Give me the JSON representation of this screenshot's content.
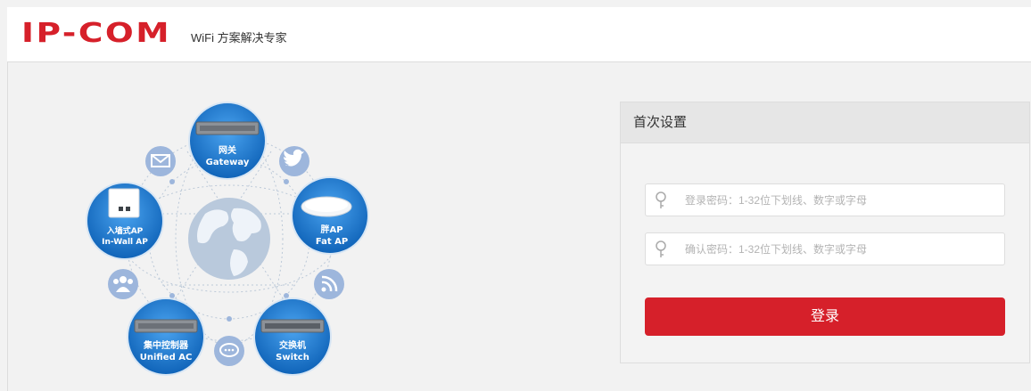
{
  "header": {
    "logo_text": "IP-COM",
    "tagline": "WiFi 方案解决专家"
  },
  "colors": {
    "brand_red": "#d6202a",
    "node_blue": "#1a7fd4",
    "small_icon_blue": "#9db6dc",
    "panel_bg": "#f3f3f3"
  },
  "illustration": {
    "nodes": [
      {
        "cn": "网关",
        "en": "Gateway",
        "icon": "gateway-device-icon"
      },
      {
        "cn": "胖AP",
        "en": "Fat AP",
        "icon": "ceiling-ap-icon"
      },
      {
        "cn": "交换机",
        "en": "Switch",
        "icon": "switch-device-icon"
      },
      {
        "cn": "集中控制器",
        "en": "Unified AC",
        "icon": "controller-device-icon"
      },
      {
        "cn": "入墙式AP",
        "en": "In-Wall AP",
        "icon": "in-wall-ap-icon"
      }
    ],
    "small_icons": [
      "mail-icon",
      "twitter-icon",
      "rss-icon",
      "chat-icon",
      "users-icon"
    ],
    "center_icon": "globe-icon"
  },
  "setup": {
    "title": "首次设置",
    "password_placeholder": "登录密码：1-32位下划线、数字或字母",
    "confirm_placeholder": "确认密码：1-32位下划线、数字或字母",
    "submit_label": "登录"
  }
}
